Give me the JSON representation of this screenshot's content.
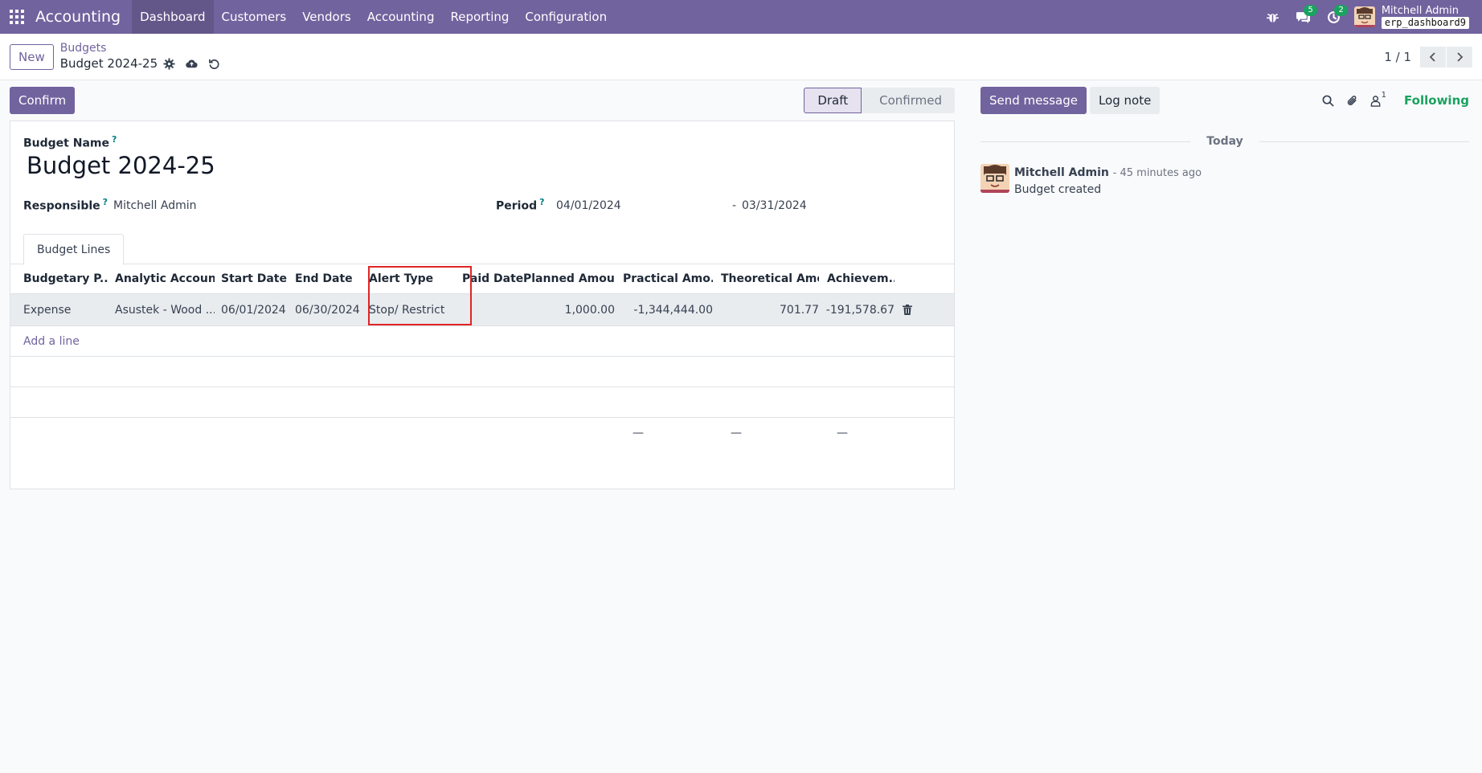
{
  "navbar": {
    "app_name": "Accounting",
    "menu": [
      "Dashboard",
      "Customers",
      "Vendors",
      "Accounting",
      "Reporting",
      "Configuration"
    ],
    "messages_badge": "5",
    "activities_badge": "2",
    "user_name": "Mitchell Admin",
    "db_name": "erp_dashboard9",
    "color": "#71639e"
  },
  "control": {
    "new_label": "New",
    "breadcrumb_parent": "Budgets",
    "breadcrumb_current": "Budget 2024-25",
    "pager_value": "1 / 1"
  },
  "form": {
    "confirm_label": "Confirm",
    "status_steps": [
      "Draft",
      "Confirmed"
    ],
    "status_current": "Draft",
    "budget_name_label": "Budget Name",
    "help_mark": "?",
    "budget_name": "Budget 2024-25",
    "responsible_label": "Responsible",
    "responsible": "Mitchell Admin",
    "period_label": "Period",
    "period_start": "04/01/2024",
    "period_separator": "-",
    "period_end": "03/31/2024",
    "tab_label": "Budget Lines",
    "columns": [
      "Budgetary P...",
      "Analytic Account",
      "Start Date",
      "End Date",
      "Alert Type",
      "Paid Date",
      "Planned Amount",
      "Practical Amo...",
      "Theoretical Amo...",
      "Achievem..."
    ],
    "rows": [
      {
        "budgetary_position": "Expense",
        "analytic_account": "Asustek - Wood ...",
        "start_date": "06/01/2024",
        "end_date": "06/30/2024",
        "alert_type": "Stop/ Restrict",
        "paid_date": "",
        "planned_amount": "1,000.00",
        "practical_amount": "-1,344,444.00",
        "theoretical_amount": "701.77",
        "achievement": "-191,578.67"
      }
    ],
    "add_line_label": "Add a line",
    "totals": [
      "—",
      "—",
      "—"
    ]
  },
  "chatter": {
    "send_label": "Send message",
    "log_label": "Log note",
    "followers_count": "1",
    "following_label": "Following",
    "date_separator": "Today",
    "messages": [
      {
        "author": "Mitchell Admin",
        "time": "- 45 minutes ago",
        "body": "Budget created"
      }
    ]
  }
}
